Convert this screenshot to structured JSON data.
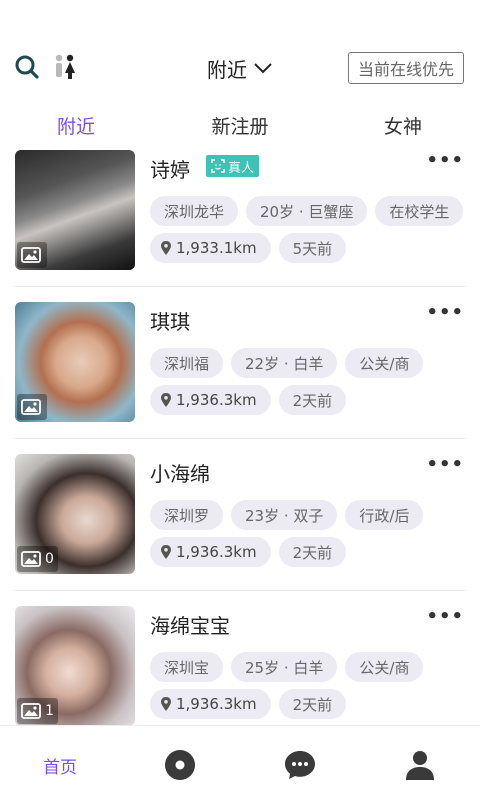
{
  "header": {
    "location_label": "附近",
    "online_button": "当前在线优先"
  },
  "tabs": [
    "附近",
    "新注册",
    "女神"
  ],
  "verified_badge": "真人",
  "more_label": "•••",
  "users": [
    {
      "name": "诗婷",
      "verified": true,
      "photo_count": "",
      "tags": [
        "深圳龙华",
        "20岁 · 巨蟹座",
        "在校学生"
      ],
      "distance": "1,933.1km",
      "time": "5天前"
    },
    {
      "name": "琪琪",
      "verified": false,
      "photo_count": "",
      "tags": [
        "深圳福",
        "22岁 · 白羊",
        "公关/商"
      ],
      "distance": "1,936.3km",
      "time": "2天前"
    },
    {
      "name": "小海绵",
      "verified": false,
      "photo_count": "0",
      "tags": [
        "深圳罗",
        "23岁 · 双子",
        "行政/后"
      ],
      "distance": "1,936.3km",
      "time": "2天前"
    },
    {
      "name": "海绵宝宝",
      "verified": false,
      "photo_count": "1",
      "tags": [
        "深圳宝",
        "25岁 · 白羊",
        "公关/商"
      ],
      "distance": "1,936.3km",
      "time": "2天前"
    }
  ],
  "bottom_nav": {
    "home": "首页"
  },
  "colors": {
    "accent": "#7a4fe0",
    "verified": "#3fc1b5",
    "tag_bg": "#ecebf4"
  }
}
